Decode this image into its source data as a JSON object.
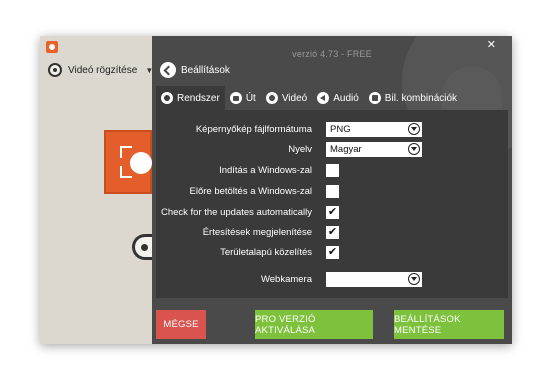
{
  "app": {
    "record_label": "Videó rögzítése",
    "version": "verzió 4.73 - FREE"
  },
  "header": {
    "back_label": "Beállítások",
    "close_icon": "✕"
  },
  "tabs": [
    {
      "label": "Rendszer",
      "icon": "gear-icon",
      "active": true
    },
    {
      "label": "Út",
      "icon": "folder-icon",
      "active": false
    },
    {
      "label": "Videó",
      "icon": "video-icon",
      "active": false
    },
    {
      "label": "Audió",
      "icon": "speaker-icon",
      "active": false
    },
    {
      "label": "Bil. kombinációk",
      "icon": "keyboard-icon",
      "active": false
    }
  ],
  "settings": {
    "screenshot_format": {
      "label": "Képernyőkép fájlformátuma",
      "value": "PNG"
    },
    "language": {
      "label": "Nyelv",
      "value": "Magyar"
    },
    "start_with_windows": {
      "label": "Indítás a Windows-zal",
      "checked": false
    },
    "preload_with_windows": {
      "label": "Előre betöltés a Windows-zal",
      "checked": false
    },
    "check_updates": {
      "label": "Check for the updates automatically",
      "checked": true
    },
    "show_notifications": {
      "label": "Értesítések megjelenítése",
      "checked": true
    },
    "area_zoom": {
      "label": "Területalapú közelítés",
      "checked": true
    },
    "webcam": {
      "label": "Webkamera",
      "value": ""
    }
  },
  "footer": {
    "cancel_label": "MÉGSE",
    "pro_label": "PRO VERZIÓ AKTIVÁLÁSA",
    "save_label": "BEÁLLÍTÁSOK MENTÉSE"
  },
  "colors": {
    "accent": "#e45e2b",
    "cancel": "#d9534f",
    "primary": "#7ec13c",
    "panel": "#3a3a3a",
    "overlay": "#4a4a4a"
  },
  "check_mark": "✔"
}
